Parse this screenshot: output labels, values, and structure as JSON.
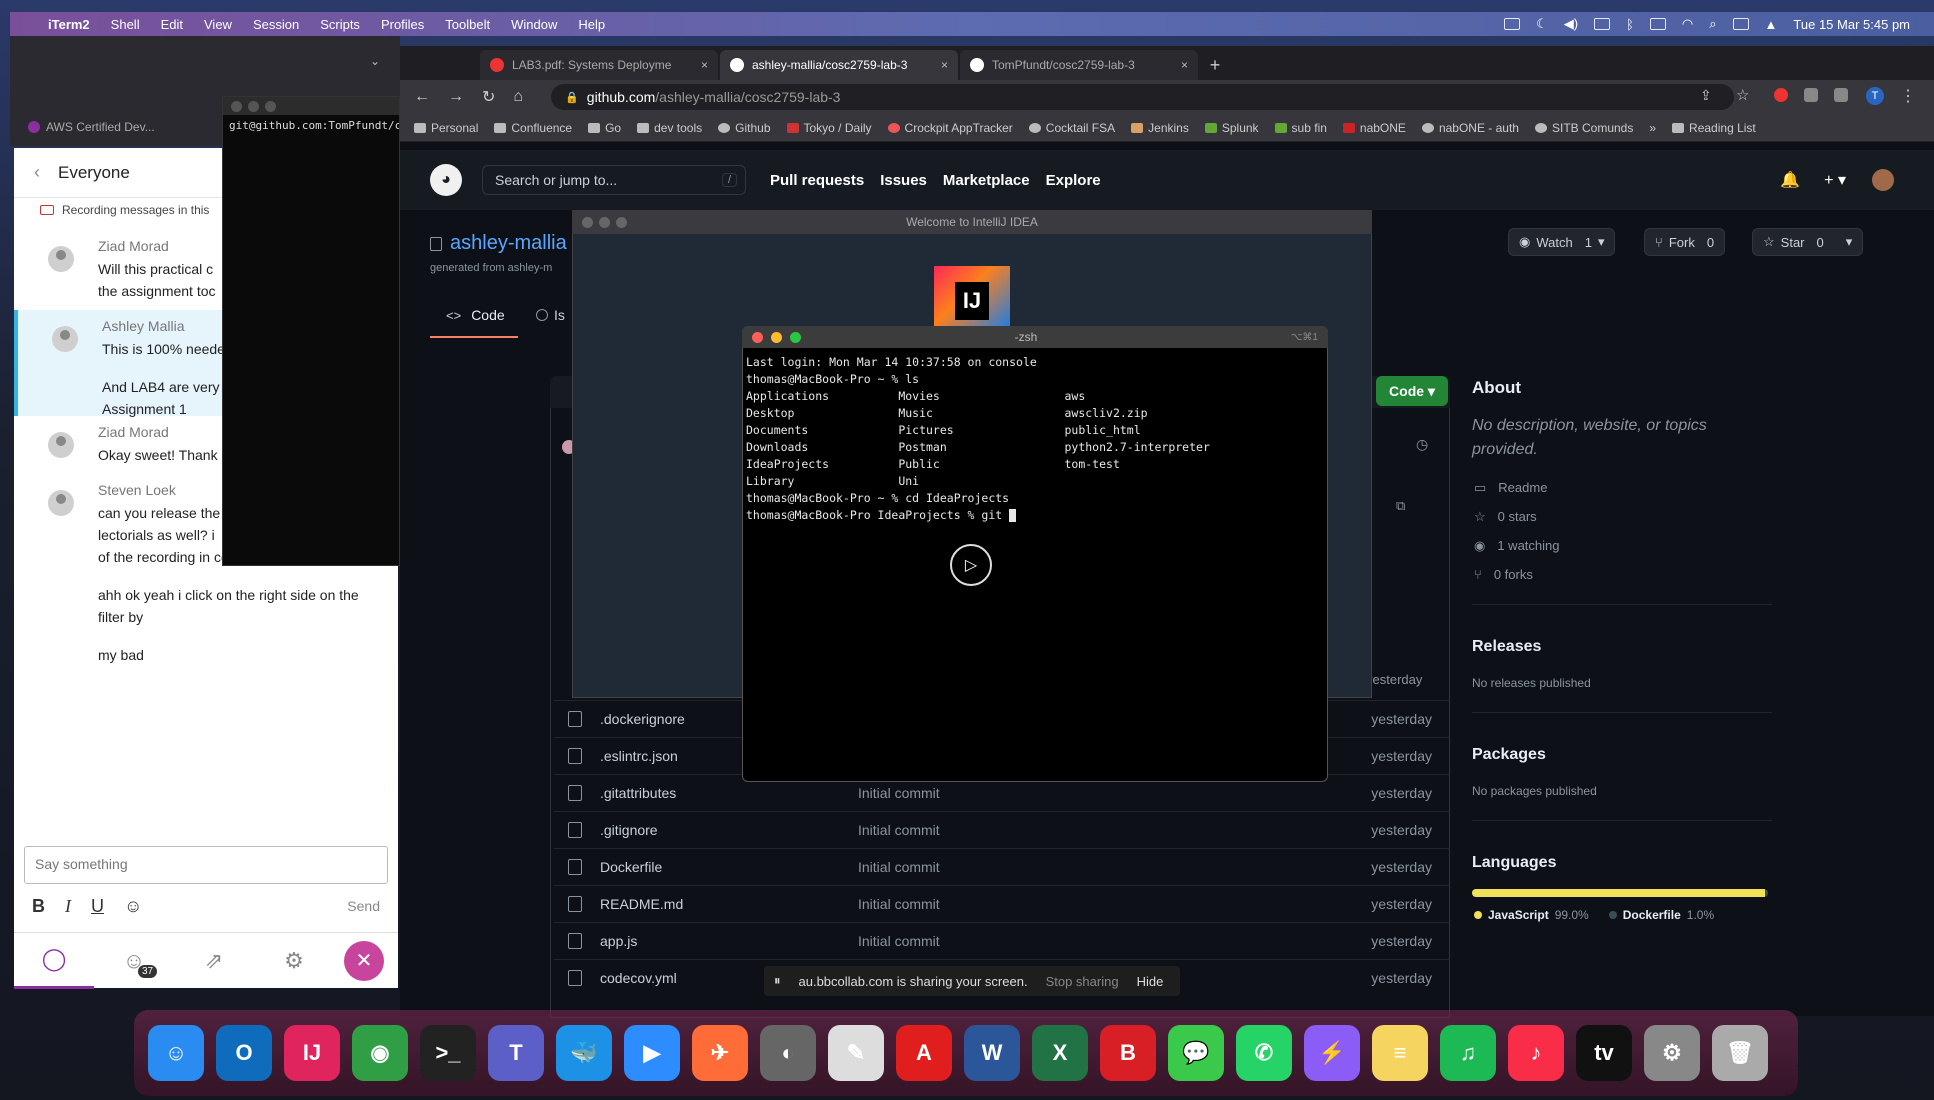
{
  "menubar": {
    "app": "iTerm2",
    "items": [
      "Shell",
      "Edit",
      "View",
      "Session",
      "Scripts",
      "Profiles",
      "Toolbelt",
      "Window",
      "Help"
    ],
    "datetime": "Tue 15 Mar  5:45 pm"
  },
  "collab": {
    "tab_label": "AWS Certified Dev...",
    "title": "Everyone",
    "recording_note": "Recording messages in this",
    "messages": [
      {
        "name": "Ziad Morad",
        "lines": [
          "Will this practical c",
          "the assignment toc"
        ]
      },
      {
        "name": "Ashley Mallia",
        "lines": [
          "This is 100% neede",
          "",
          "And LAB4 are very",
          "Assignment 1"
        ]
      },
      {
        "name": "Ziad Morad",
        "lines": [
          "Okay sweet! Thank"
        ]
      },
      {
        "name": "Steven Loek",
        "lines": [
          "can you release the",
          "lectorials as well? i",
          "of the recording in collaborate ultra",
          "",
          "ahh ok yeah i click on the right side on the",
          "filter by",
          "",
          "my bad"
        ]
      }
    ],
    "composer_placeholder": "Say something",
    "send_label": "Send",
    "badge_count": "37"
  },
  "iterm": {
    "line": "git@github.com:TomPfundt/c"
  },
  "browser": {
    "tabs": [
      {
        "label": "LAB3.pdf: Systems Deployme",
        "active": false
      },
      {
        "label": "ashley-mallia/cosc2759-lab-3",
        "active": true
      },
      {
        "label": "TomPfundt/cosc2759-lab-3",
        "active": false
      }
    ],
    "url_host": "github.com",
    "url_path": "/ashley-mallia/cosc2759-lab-3",
    "bookmarks": [
      "Personal",
      "Confluence",
      "Go",
      "dev tools",
      "Github",
      "Tokyo / Daily",
      "Crockpit AppTracker",
      "Cocktail FSA",
      "Jenkins",
      "Splunk",
      "sub fin",
      "nabONE",
      "nabONE - auth",
      "SITB Comunds"
    ],
    "reading_list": "Reading List"
  },
  "github": {
    "search_placeholder": "Search or jump to...",
    "search_key": "/",
    "nav": [
      "Pull requests",
      "Issues",
      "Marketplace",
      "Explore"
    ],
    "repo_owner": "ashley-mallia",
    "generated_from": "generated from ashley-m",
    "watch": {
      "label": "Watch",
      "count": "1"
    },
    "fork": {
      "label": "Fork",
      "count": "0"
    },
    "star": {
      "label": "Star",
      "count": "0"
    },
    "tab_code": "Code",
    "tab_issues": "Is",
    "code_button": "Code",
    "files": [
      {
        "name": ".dockerignore",
        "commit": "",
        "date": "yesterday"
      },
      {
        "name": ".eslintrc.json",
        "commit": "",
        "date": "yesterday"
      },
      {
        "name": ".gitattributes",
        "commit": "Initial commit",
        "date": "yesterday"
      },
      {
        "name": ".gitignore",
        "commit": "Initial commit",
        "date": "yesterday"
      },
      {
        "name": "Dockerfile",
        "commit": "Initial commit",
        "date": "yesterday"
      },
      {
        "name": "README.md",
        "commit": "Initial commit",
        "date": "yesterday"
      },
      {
        "name": "app.js",
        "commit": "Initial commit",
        "date": "yesterday"
      },
      {
        "name": "codecov.yml",
        "commit": "",
        "date": "yesterday"
      }
    ],
    "partial_date": "yesterday",
    "about": {
      "heading": "About",
      "description": "No description, website, or topics provided.",
      "readme": "Readme",
      "stars": "0 stars",
      "watching": "1 watching",
      "forks": "0 forks"
    },
    "releases": {
      "heading": "Releases",
      "text": "No releases published"
    },
    "packages": {
      "heading": "Packages",
      "text": "No packages published"
    },
    "languages": {
      "heading": "Languages",
      "items": [
        {
          "name": "JavaScript",
          "percent": "99.0%",
          "value": 99.0,
          "color": "#f1e05a"
        },
        {
          "name": "Dockerfile",
          "percent": "1.0%",
          "value": 1.0,
          "color": "#384d54"
        }
      ]
    }
  },
  "intellij": {
    "title": "Welcome to IntelliJ IDEA",
    "logo_text": "IJ"
  },
  "terminal": {
    "title": "-zsh",
    "shortcut": "⌥⌘1",
    "lines": [
      "Last login: Mon Mar 14 10:37:58 on console",
      "thomas@MacBook-Pro ~ % ls",
      "Applications          Movies                  aws",
      "Desktop               Music                   awscliv2.zip",
      "Documents             Pictures                public_html",
      "Downloads             Postman                 python2.7-interpreter",
      "IdeaProjects          Public                  tom-test",
      "Library               Uni",
      "thomas@MacBook-Pro ~ % cd IdeaProjects",
      "thomas@MacBook-Pro IdeaProjects % git "
    ]
  },
  "share_banner": {
    "text": "au.bbcollab.com is sharing your screen.",
    "stop": "Stop sharing",
    "hide": "Hide"
  },
  "dock": {
    "apps": [
      {
        "name": "finder",
        "glyph": "☺",
        "color": "#2a8cf0"
      },
      {
        "name": "outlook",
        "glyph": "O",
        "color": "#0f6cbd"
      },
      {
        "name": "intellij",
        "glyph": "IJ",
        "color": "#e0245e"
      },
      {
        "name": "chrome",
        "glyph": "◉",
        "color": "#2f9e44"
      },
      {
        "name": "terminal",
        "glyph": ">_",
        "color": "#222"
      },
      {
        "name": "teams",
        "glyph": "T",
        "color": "#5b5fc7"
      },
      {
        "name": "docker",
        "glyph": "🐳",
        "color": "#1d91e6"
      },
      {
        "name": "zoom",
        "glyph": "▶",
        "color": "#2d8cff"
      },
      {
        "name": "postman",
        "glyph": "✈",
        "color": "#ff6c37"
      },
      {
        "name": "disk-utility",
        "glyph": "◐",
        "color": "#666"
      },
      {
        "name": "textedit",
        "glyph": "✎",
        "color": "#ddd"
      },
      {
        "name": "acrobat",
        "glyph": "A",
        "color": "#e01e1e"
      },
      {
        "name": "word",
        "glyph": "W",
        "color": "#2b579a"
      },
      {
        "name": "excel",
        "glyph": "X",
        "color": "#217346"
      },
      {
        "name": "bitdefender",
        "glyph": "B",
        "color": "#d81f26"
      },
      {
        "name": "messages",
        "glyph": "💬",
        "color": "#3bc94b"
      },
      {
        "name": "whatsapp",
        "glyph": "✆",
        "color": "#25d366"
      },
      {
        "name": "messenger",
        "glyph": "⚡",
        "color": "#8b5cf6"
      },
      {
        "name": "notes",
        "glyph": "≡",
        "color": "#f5d560"
      },
      {
        "name": "spotify",
        "glyph": "♫",
        "color": "#1db954"
      },
      {
        "name": "music",
        "glyph": "♪",
        "color": "#fa2d48"
      },
      {
        "name": "apple-tv",
        "glyph": "tv",
        "color": "#111"
      },
      {
        "name": "system-preferences",
        "glyph": "⚙",
        "color": "#888"
      },
      {
        "name": "trash",
        "glyph": "🗑",
        "color": "#aaa"
      }
    ]
  }
}
